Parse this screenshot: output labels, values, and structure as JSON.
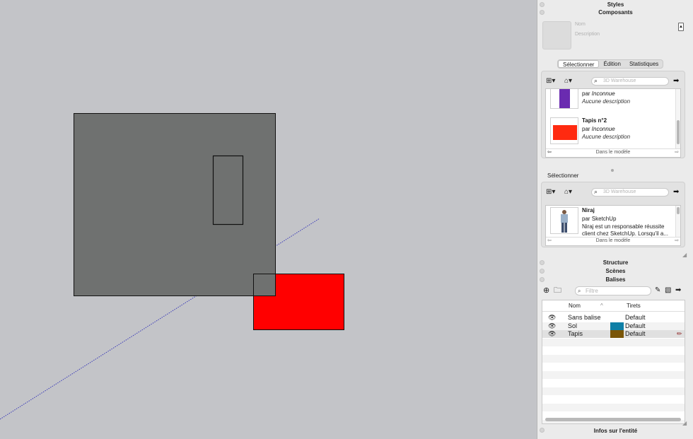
{
  "viewport": {
    "colors": {
      "background": "#c3c4c8",
      "gray_square": "#6f7170",
      "red_rect": "#ff0000",
      "axis": "#3b3bb8"
    }
  },
  "tray": {
    "styles_title": "Styles",
    "components_title": "Composants",
    "name_placeholder": "Nom",
    "description_placeholder": "Description",
    "tabs": [
      {
        "label": "Sélectionner",
        "active": true
      },
      {
        "label": "Édition",
        "active": false
      },
      {
        "label": "Statistiques",
        "active": false
      }
    ],
    "search_placeholder": "3D Warehouse",
    "model_list": {
      "items": [
        {
          "name": "",
          "author_prefix": "par",
          "author": "Inconnue",
          "description": "Aucune description",
          "color": "#6a2bb0"
        },
        {
          "name": "Tapis n°2",
          "author_prefix": "par",
          "author": "Inconnue",
          "description": "Aucune description",
          "color": "#ff2a10"
        }
      ],
      "footer": "Dans le modèle"
    },
    "secondary_label": "Sélectionner",
    "secondary_list": {
      "items": [
        {
          "name": "Niraj",
          "author_prefix": "par",
          "author": "SketchUp",
          "description": "Niraj est un responsable réussite client chez SketchUp. Lorsqu'il a..."
        }
      ],
      "footer": "Dans le modèle"
    },
    "structure_title": "Structure",
    "scenes_title": "Scènes",
    "tags_title": "Balises",
    "filter_placeholder": "Filtre",
    "tags_table": {
      "col_name": "Nom",
      "col_dashes": "Tirets",
      "rows": [
        {
          "name": "Sans balise",
          "dashes": "Default",
          "color": ""
        },
        {
          "name": "Sol",
          "dashes": "Default",
          "color": "#0e7fa6"
        },
        {
          "name": "Tapis",
          "dashes": "Default",
          "color": "#7a5608"
        }
      ]
    },
    "entity_info_title": "Infos sur l'entité"
  }
}
